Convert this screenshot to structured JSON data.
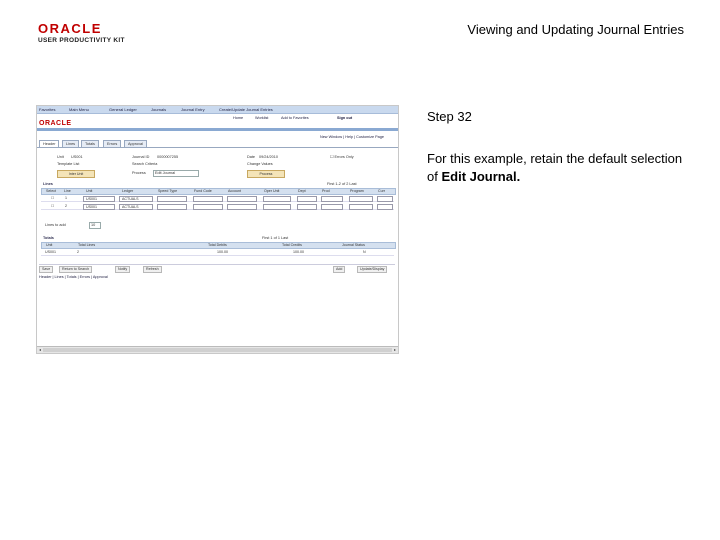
{
  "logo": {
    "wordmark": "ORACLE",
    "subtitle": "USER PRODUCTIVITY KIT"
  },
  "header": {
    "title": "Viewing and Updating Journal Entries"
  },
  "screenshot": {
    "brand": "ORACLE",
    "breadcrumb": [
      "Favorites",
      "Main Menu",
      "General Ledger",
      "Journals",
      "Journal Entry",
      "Create/Update Journal Entries"
    ],
    "utility_links": [
      "Home",
      "Worklist",
      "Add to Favorites",
      "Sign out"
    ],
    "page_links": [
      "New Window",
      "Help",
      "Customize Page"
    ],
    "tabs": [
      "Header",
      "Lines",
      "Totals",
      "Errors",
      "Approval"
    ],
    "header_fields": {
      "unit_label": "Unit",
      "unit_value": "US001",
      "journal_label": "Journal ID",
      "journal_value": "0000007255",
      "date_label": "Date",
      "date_value": "09/24/2010",
      "errors_only": "Errors Only",
      "template_label": "Template List",
      "search_criteria": "Search Criteria",
      "change_values": "Change Values",
      "inter_unit": "Inter Unit",
      "process_label": "Process",
      "process_value": "Edit Journal",
      "process_button": "Process"
    },
    "lines_grid": {
      "section": "Lines",
      "nav": "First 1-2 of 2 Last",
      "columns": [
        "Select",
        "Line",
        "Unit",
        "Ledger",
        "Speed Type",
        "Fund Code",
        "Account",
        "Oper Unit",
        "Dept",
        "Prod",
        "Program",
        "Curr"
      ],
      "rows": [
        {
          "line": "1",
          "unit": "US001",
          "ledger": "ACTUALS"
        },
        {
          "line": "2",
          "unit": "US001",
          "ledger": "ACTUALS"
        }
      ],
      "lines_to_add_label": "Lines to add",
      "lines_to_add_value": "10"
    },
    "totals_grid": {
      "section": "Totals",
      "nav": "First 1 of 1 Last",
      "columns": [
        "Unit",
        "Total Lines",
        "Total Debits",
        "Total Credits",
        "Journal Status"
      ],
      "row": {
        "unit": "US001",
        "lines": "2",
        "debits": "100.00",
        "credits": "100.00",
        "status": "N"
      }
    },
    "toolbar": [
      "Save",
      "Return to Search",
      "Notify",
      "Refresh",
      "Add",
      "Update/Display"
    ],
    "footer_links": "Header | Lines | Totals | Errors | Approval"
  },
  "step": {
    "label": "Step 32"
  },
  "instruction": {
    "text": "For this example, retain the default selection of ",
    "emphasis": "Edit Journal",
    "suffix": "."
  }
}
